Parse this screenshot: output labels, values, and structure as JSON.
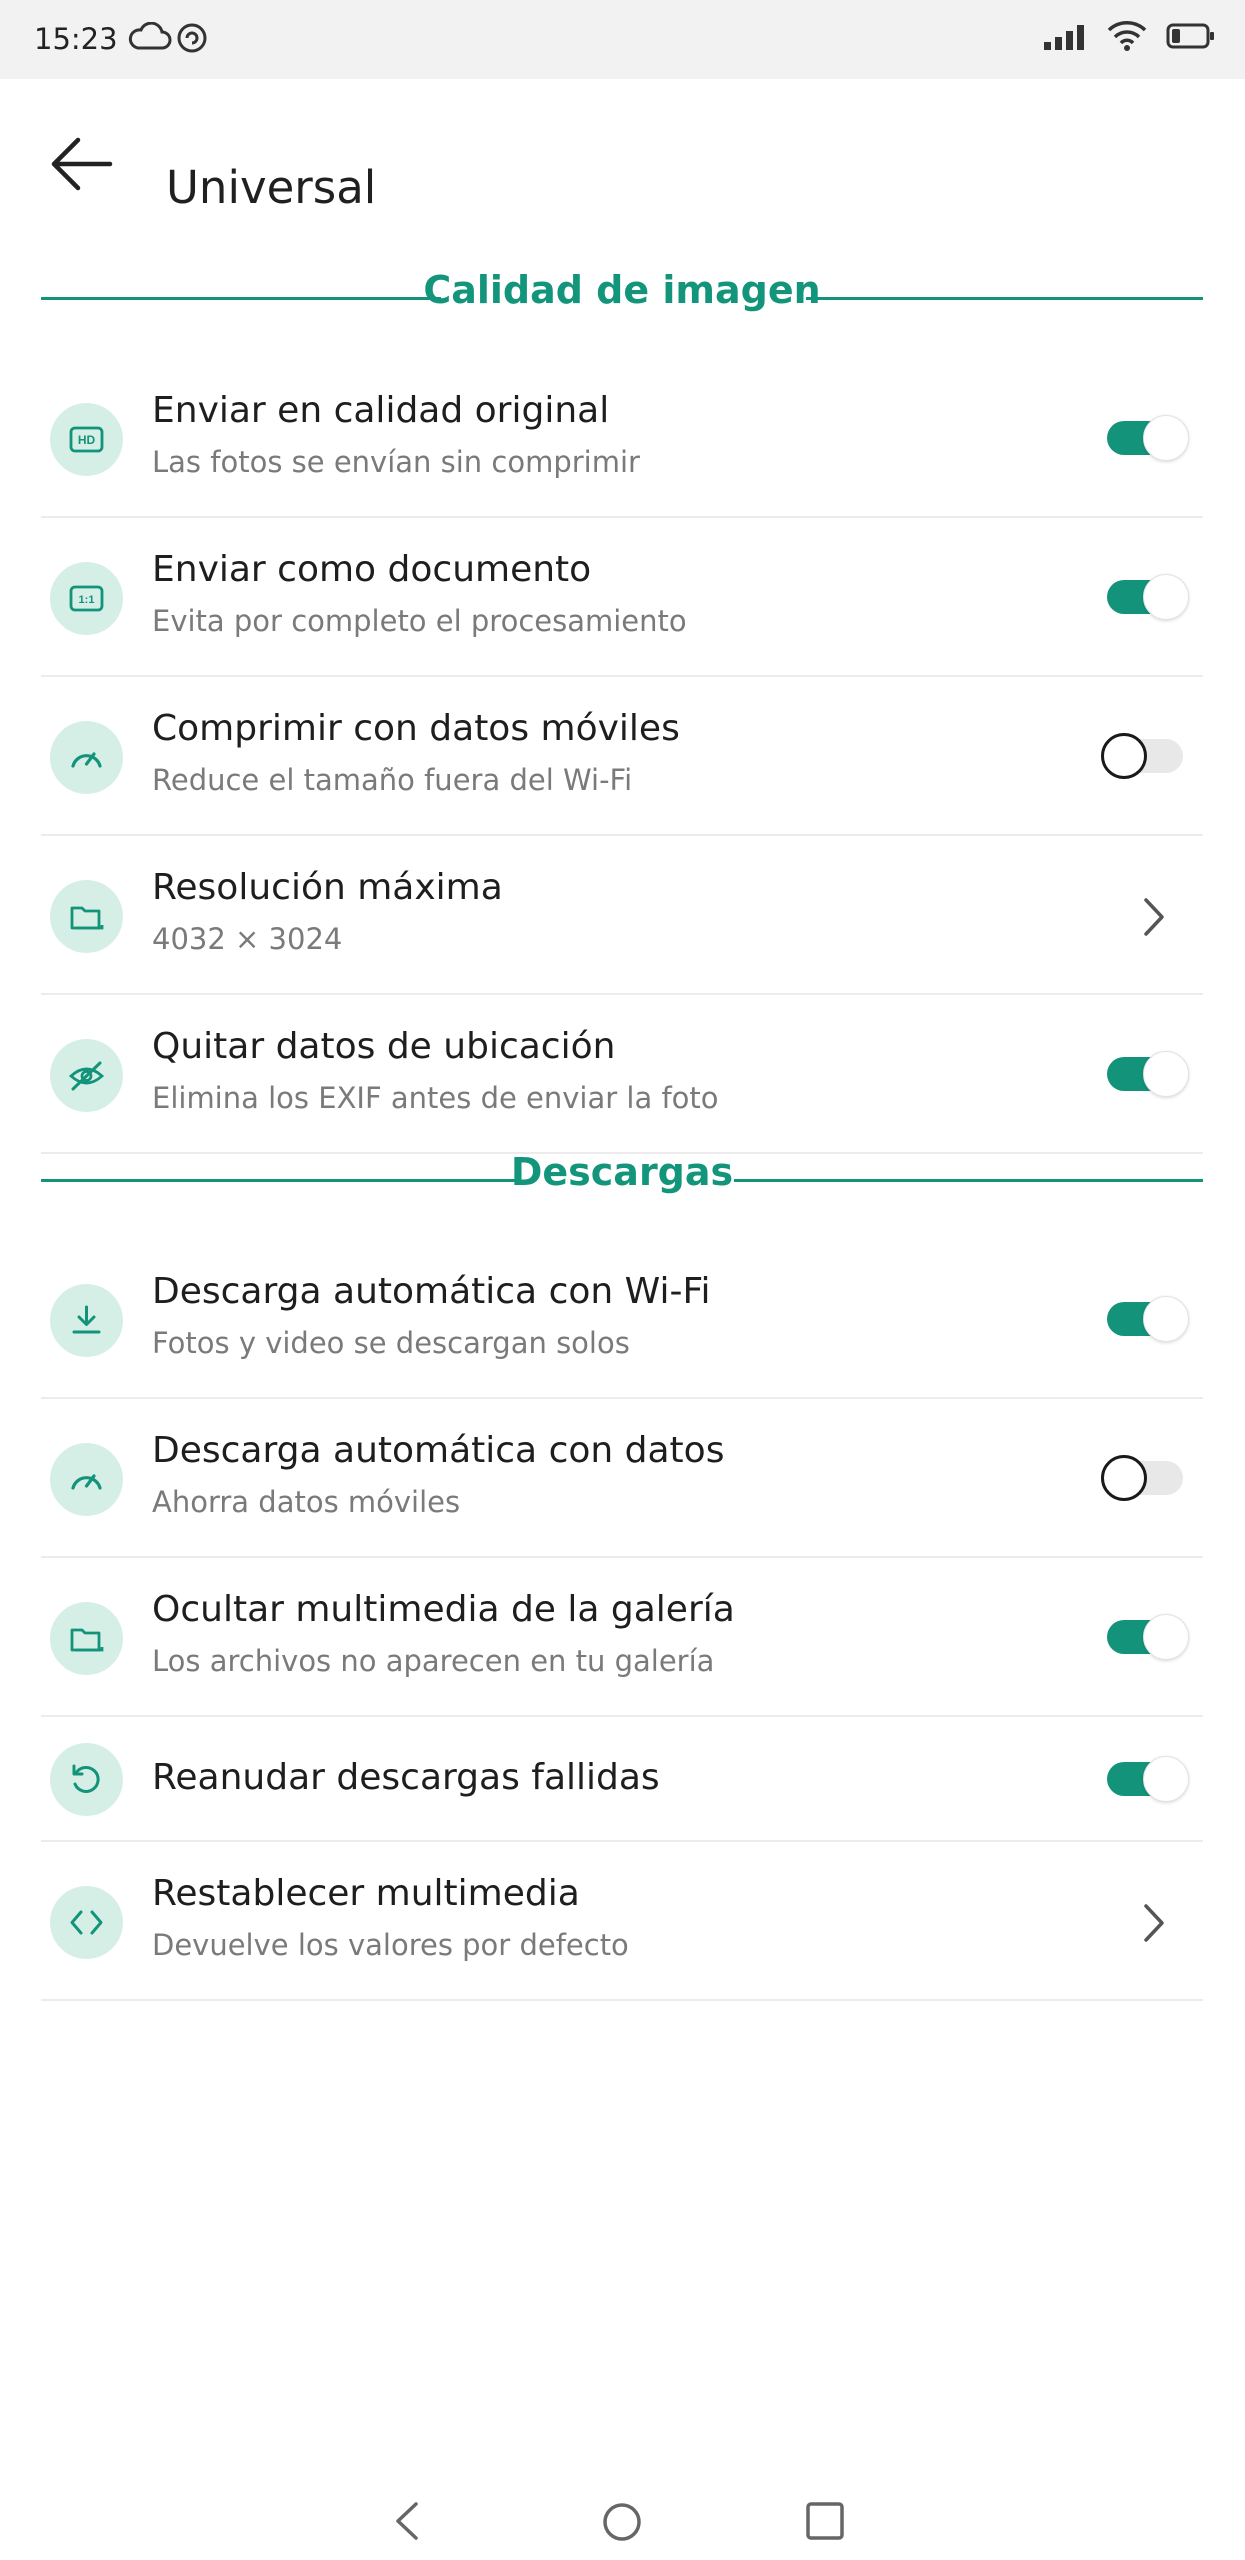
{
  "status_bar": {
    "time": "15:23"
  },
  "app_bar": {
    "title": "Universal"
  },
  "sections": [
    {
      "title": "Calidad de imagen",
      "items": [
        {
          "label": "Enviar en calidad original",
          "subtitle": "Las fotos se envían sin comprimir",
          "icon": "hd-icon",
          "control": "toggle",
          "state": "on"
        },
        {
          "label": "Enviar como documento",
          "subtitle": "Evita por completo el procesamiento",
          "icon": "ratio-icon",
          "control": "toggle",
          "state": "on"
        },
        {
          "label": "Comprimir con datos móviles",
          "subtitle": "Reduce el tamaño fuera del Wi-Fi",
          "icon": "speedometer-icon",
          "control": "toggle",
          "state": "off"
        },
        {
          "label": "Resolución máxima",
          "subtitle": "4032 × 3024",
          "icon": "folder-icon",
          "control": "chevron"
        },
        {
          "label": "Quitar datos de ubicación",
          "subtitle": "Elimina los EXIF antes de enviar la foto",
          "icon": "eye-off-icon",
          "control": "toggle",
          "state": "on"
        }
      ]
    },
    {
      "title": "Descargas",
      "items": [
        {
          "label": "Descarga automática con Wi-Fi",
          "subtitle": "Fotos y video se descargan solos",
          "icon": "download-icon",
          "control": "toggle",
          "state": "on"
        },
        {
          "label": "Descarga automática con datos",
          "subtitle": "Ahorra datos móviles",
          "icon": "speedometer-icon",
          "control": "toggle",
          "state": "off"
        },
        {
          "label": "Ocultar multimedia de la galería",
          "subtitle": "Los archivos no aparecen en tu galería",
          "icon": "folder-icon",
          "control": "toggle",
          "state": "on"
        },
        {
          "label": "Reanudar descargas fallidas",
          "icon": "refresh-icon",
          "control": "toggle",
          "state": "on"
        },
        {
          "label": "Restablecer multimedia",
          "subtitle": "Devuelve los valores por defecto",
          "icon": "code-icon",
          "control": "chevron"
        }
      ]
    }
  ],
  "colors": {
    "accent": "#12937a",
    "icon_bg": "#d6efe6",
    "toggle_off": "#e8e8e8"
  }
}
